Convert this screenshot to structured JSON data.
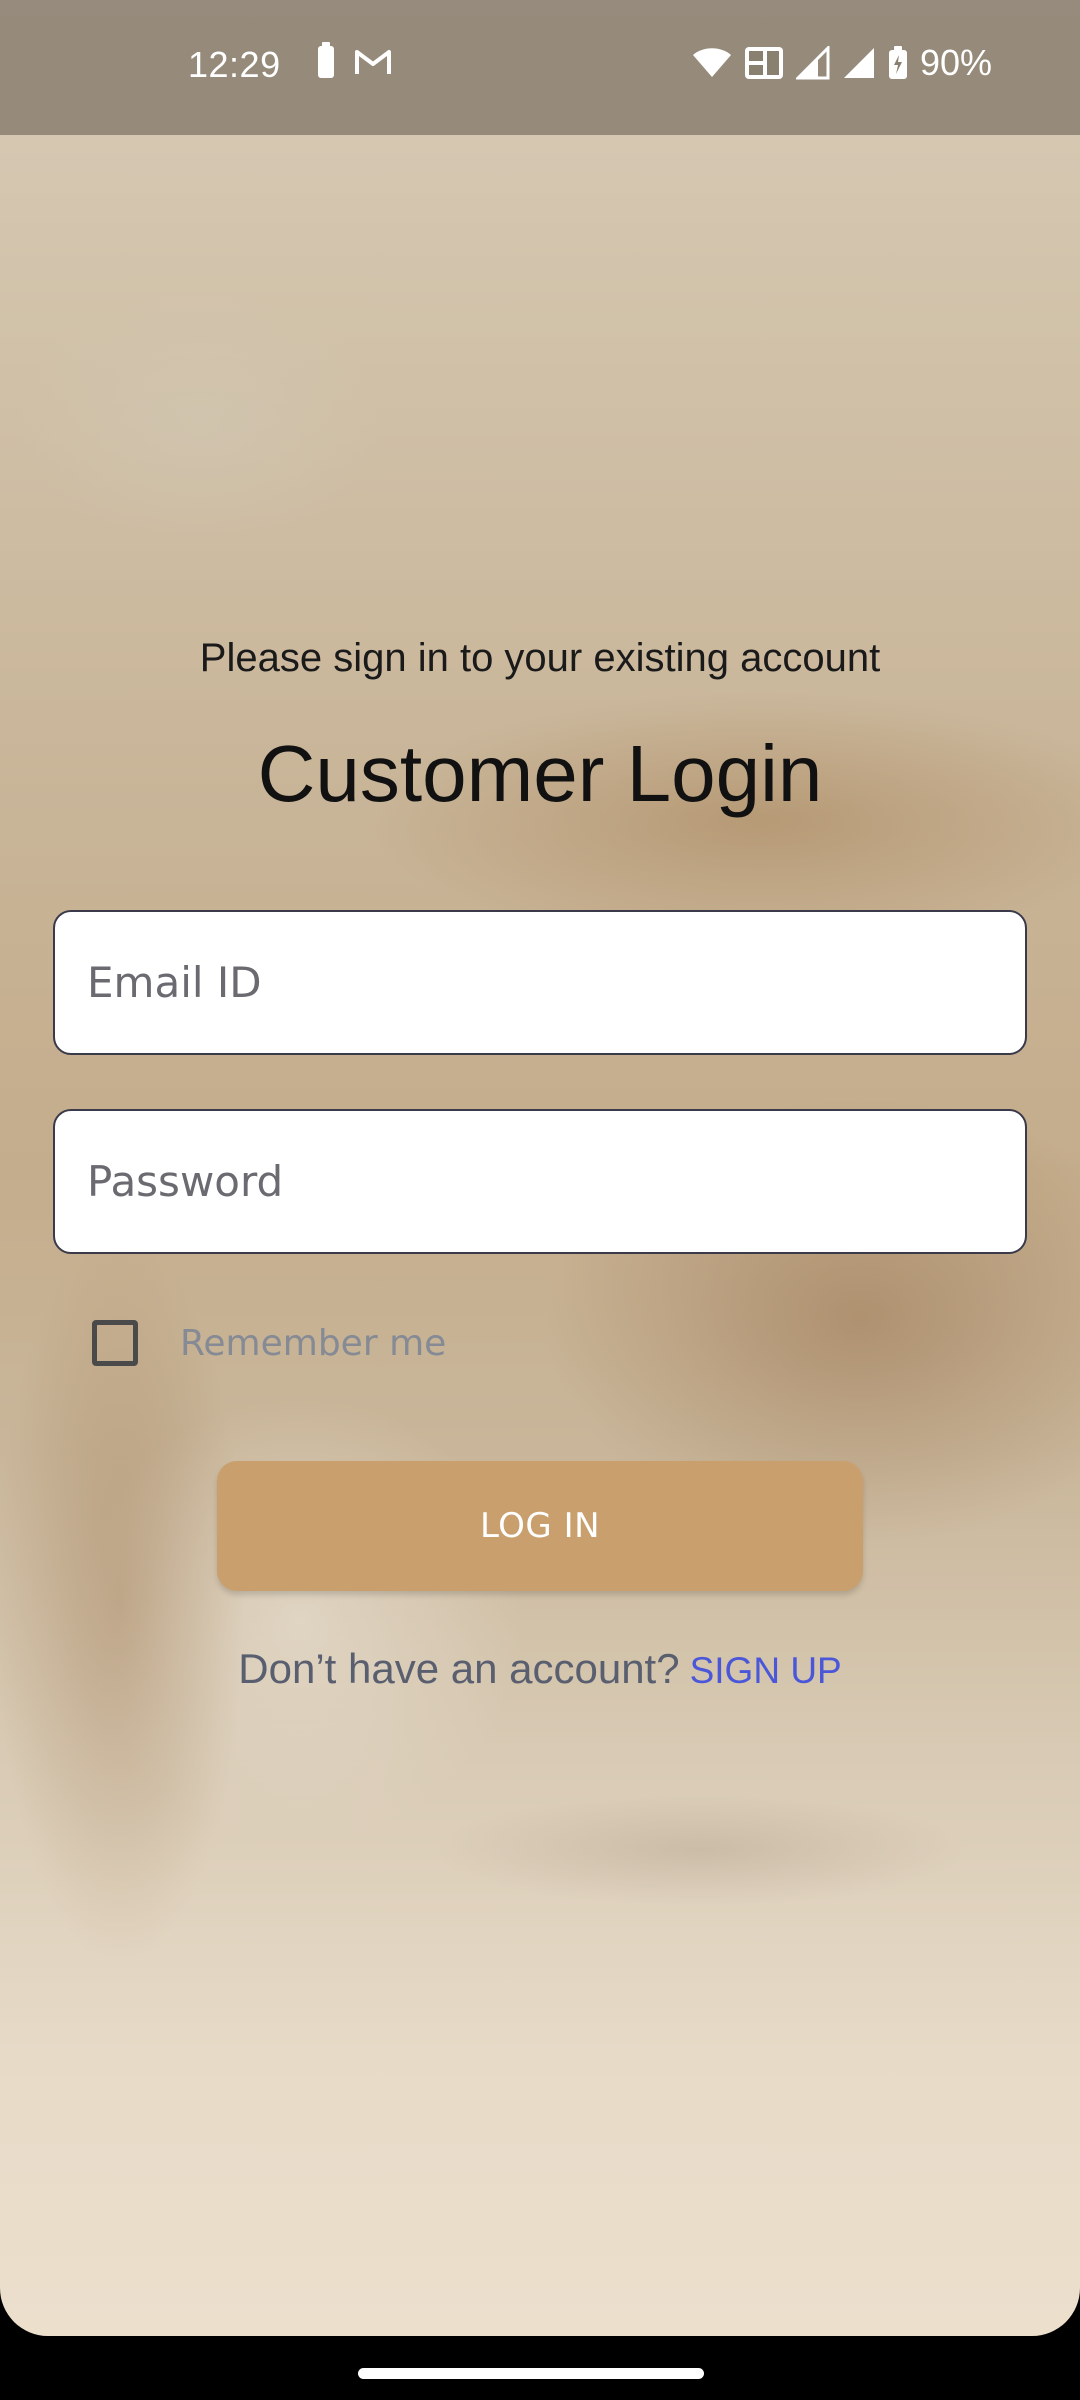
{
  "status_bar": {
    "time": "12:29",
    "battery_pct": "90%",
    "icons": [
      "battery-icon",
      "gmail-icon",
      "wifi-icon",
      "volte-icon",
      "signal-icon",
      "signal-icon",
      "battery-charging-icon"
    ]
  },
  "login": {
    "subtitle": "Please sign in to your existing account",
    "title": "Customer Login",
    "email_placeholder": "Email ID",
    "password_placeholder": "Password",
    "remember_label": "Remember me",
    "remember_checked": false,
    "login_button": "LOG IN",
    "no_account_text": "Don’t have an account?",
    "signup_link": "SIGN UP"
  },
  "colors": {
    "button": "#c9a06d",
    "link": "#4b57d9"
  }
}
